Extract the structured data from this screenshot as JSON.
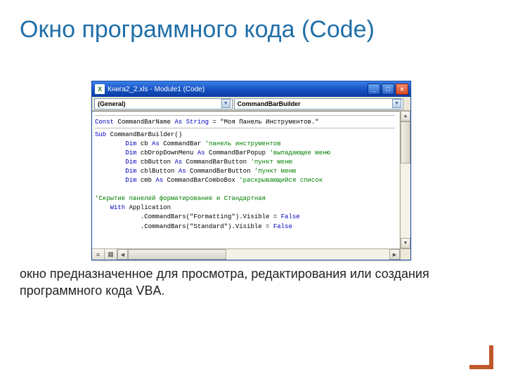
{
  "slide": {
    "title": "Окно программного кода (Code)",
    "description": "окно предназначенное для  просмотра, редактирования или создания программного кода VBA."
  },
  "window": {
    "icon_text": "X",
    "title": "Книга2_2.xls - Module1 (Code)",
    "buttons": {
      "min": "_",
      "max": "□",
      "close": "×"
    }
  },
  "dropdowns": {
    "left": "(General)",
    "right": "CommandBarBuilder",
    "arrow": "▼"
  },
  "scroll": {
    "up": "▲",
    "down": "▼",
    "left": "◀",
    "right": "▶"
  },
  "viewbtns": {
    "a": "≡",
    "b": "▦"
  },
  "code": {
    "l1_kw": "Const",
    "l1_mid": " CommandBarName ",
    "l1_kw2": "As String",
    "l1_eq": " = ",
    "l1_str": "\"Моя Панель Инструментов.\"",
    "l2_kw": "Sub",
    "l2_rest": " CommandBarBuilder()",
    "l3_kw": "Dim",
    "l3_a": " cb ",
    "l3_kw2": "As",
    "l3_b": " CommandBar ",
    "l3_cm": "'панель инструментов",
    "l4_kw": "Dim",
    "l4_a": " cbDropDownMenu ",
    "l4_kw2": "As",
    "l4_b": " CommandBarPopup ",
    "l4_cm": "'выпадающее меню",
    "l5_kw": "Dim",
    "l5_a": " cbButton ",
    "l5_kw2": "As",
    "l5_b": " CommandBarButton ",
    "l5_cm": "'пункт меню",
    "l6_kw": "Dim",
    "l6_a": " cblButton ",
    "l6_kw2": "As",
    "l6_b": " CommandBarButton ",
    "l6_cm": "'пункт меню",
    "l7_kw": "Dim",
    "l7_a": " cmb ",
    "l7_kw2": "As",
    "l7_b": " CommandBarComboBox ",
    "l7_cm": "'раскрывающийся список",
    "l8_cm": "'Скрытие панелей форматирование и Стандартная",
    "l9_kw": "With",
    "l9_rest": " Application",
    "l10_a": "            .CommandBars(\"Formatting\").Visible = ",
    "l10_kw": "False",
    "l11_a": "            .CommandBars(\"Standard\").Visible = ",
    "l11_kw": "False"
  }
}
